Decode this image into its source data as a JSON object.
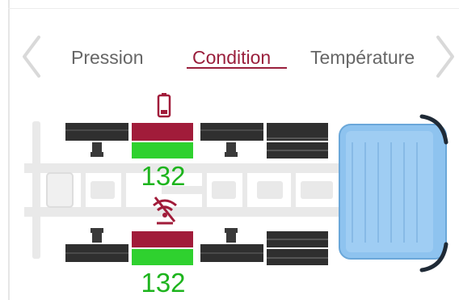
{
  "nav": {
    "prev_icon": "chevron-left-icon",
    "next_icon": "chevron-right-icon"
  },
  "tabs": [
    {
      "label": "Pression",
      "active": false
    },
    {
      "label": "Condition",
      "active": true
    },
    {
      "label": "Température",
      "active": false
    }
  ],
  "tires": {
    "upper_value": "132",
    "lower_value": "132"
  },
  "icons": {
    "battery": "battery-low-icon",
    "no_signal": "no-signal-icon"
  },
  "colors": {
    "accent": "#9a1f3c",
    "tire_ok": "#2fd12f",
    "tire_alert": "#a11c3a",
    "cab": "#8ec3ef"
  }
}
